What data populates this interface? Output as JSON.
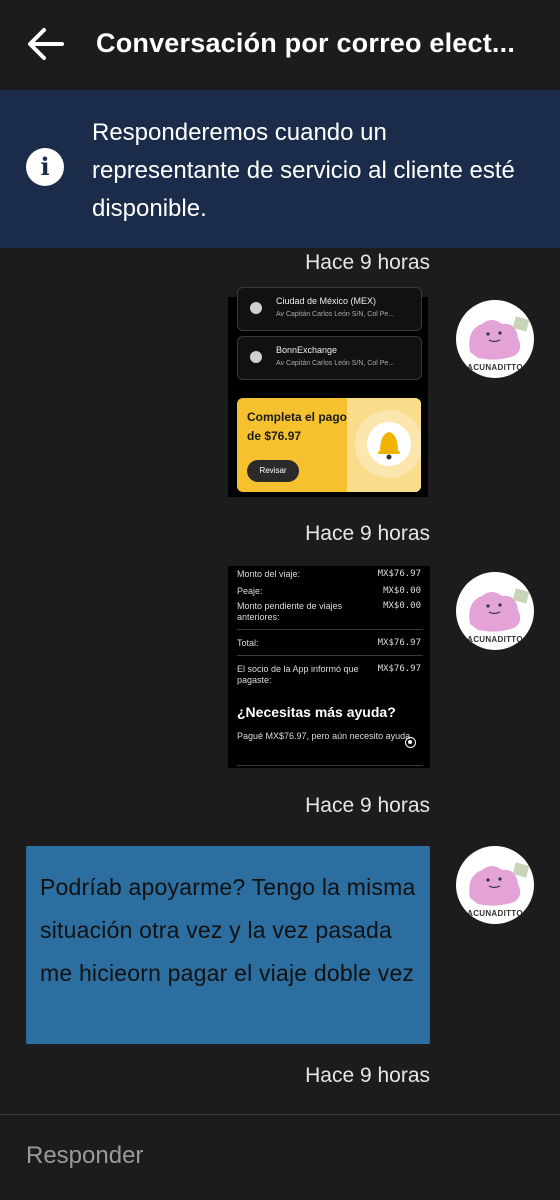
{
  "header": {
    "back_icon": "arrow-left-icon",
    "title": "Conversación por correo elect..."
  },
  "banner": {
    "icon": "info-icon",
    "info_glyph": "i",
    "text": "Responderemos cuando un representante de servicio al cliente esté disponible."
  },
  "messages": [
    {
      "timestamp": "Hace 9 horas",
      "avatar_label": "ACUNADITTO",
      "locations": [
        {
          "title": "Ciudad de México (MEX)",
          "address": "Av Capitán Carlos León S/N, Col Pe..."
        },
        {
          "title": "BonnExchange",
          "address": "Av Capitán Carlos León S/N, Col Pe..."
        }
      ],
      "pay_card": {
        "title": "Completa el pago de $76.97",
        "button": "Revisar"
      }
    },
    {
      "timestamp": "Hace 9 horas",
      "avatar_label": "ACUNADITTO",
      "fare_rows": [
        {
          "label": "Monto del viaje:",
          "value": "MX$76.97"
        },
        {
          "label": "Peaje:",
          "value": "MX$0.00"
        },
        {
          "label": "Monto pendiente de viajes anteriores:",
          "value": "MX$0.00"
        },
        {
          "label": "Total:",
          "value": "MX$76.97"
        },
        {
          "label": "El socio de la App informó que pagaste:",
          "value": "MX$76.97"
        }
      ],
      "help_title": "¿Necesitas más ayuda?",
      "help_option": "Pagué MX$76.97, pero aún necesito ayuda"
    },
    {
      "timestamp": "Hace 9 horas",
      "avatar_label": "ACUNADITTO",
      "text": "Podríab apoyarme? Tengo la misma situación otra vez y la vez pasada me hicieorn pagar el viaje doble vez"
    }
  ],
  "last_timestamp": "Hace 9 horas",
  "reply": {
    "placeholder": "Responder"
  },
  "colors": {
    "background": "#1c1c1e",
    "banner": "#1b2c4a",
    "bubble": "#2c6ea0",
    "pay_card": "#f6c12e"
  }
}
